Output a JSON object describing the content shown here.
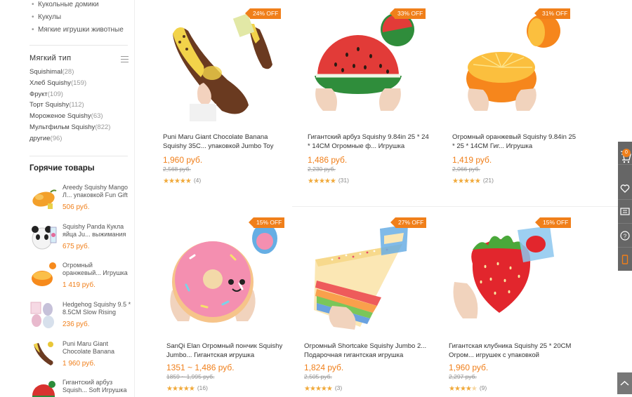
{
  "categories": [
    "Кукольные домики",
    "Кукулы",
    "Мягкие игрушки животные"
  ],
  "soft_type": {
    "title": "Мягкий тип",
    "items": [
      {
        "label": "Squishimal",
        "count": "(28)"
      },
      {
        "label": "Хлеб Squishy",
        "count": "(159)"
      },
      {
        "label": "Фрукт",
        "count": "(109)"
      },
      {
        "label": "Торт Squishy",
        "count": "(112)"
      },
      {
        "label": "Мороженое Squishy",
        "count": "(63)"
      },
      {
        "label": "Мультфильм Squishy",
        "count": "(822)"
      },
      {
        "label": "другие",
        "count": "(96)"
      }
    ]
  },
  "hot": {
    "title": "Горячие товары",
    "items": [
      {
        "name": "Areedy Squishy Mango Л... упаковкой Fun Gift",
        "price": "506 руб."
      },
      {
        "name": "Squishy Panda Кукла яйца Ju... выжимания",
        "price": "675 руб."
      },
      {
        "name": "Огромный оранжевый... Игрушка",
        "price": "1 419 руб."
      },
      {
        "name": "Hedgehog Squishy 9.5 * 8.5CM Slow Rising",
        "price": "236 руб."
      },
      {
        "name": "Puni Maru Giant Chocolate Banana",
        "price": "1 960 руб."
      },
      {
        "name": "Гигантский арбуз Squish... Soft Игрушка",
        "price": ""
      }
    ]
  },
  "products": [
    {
      "badge": "24% OFF",
      "title": "Puni Maru Giant Chocolate Banana Squishy 35C... упаковкой Jumbo Toy",
      "price": "1,960 руб.",
      "old": "2,568 руб.",
      "reviews": "(4)",
      "rating": 5
    },
    {
      "badge": "33% OFF",
      "title": "Гигантский арбуз Squishy 9.84in 25 * 24 * 14CM Огромные ф... Игрушка",
      "price": "1,486 руб.",
      "old": "2,230 руб.",
      "reviews": "(31)",
      "rating": 5
    },
    {
      "badge": "31% OFF",
      "title": "Огромный оранжевый Squishy 9.84in 25 * 25 * 14CM Гиг... Игрушка",
      "price": "1,419 руб.",
      "old": "2,066 руб.",
      "reviews": "(21)",
      "rating": 5
    },
    {
      "badge": "15% OFF",
      "title": "SanQi Elan Огромный пончик Squishy Jumbo... Гигантская игрушка",
      "price": "1351 ~ 1,486 руб.",
      "old": "1859 ~ 1,995 руб.",
      "reviews": "(16)",
      "rating": 5
    },
    {
      "badge": "27% OFF",
      "title": "Огромный Shortcake Squishy Jumbo 2... Подарочная гигантская игрушка",
      "price": "1,824 руб.",
      "old": "2,505 руб.",
      "reviews": "(3)",
      "rating": 5
    },
    {
      "badge": "15% OFF",
      "title": "Гигантская клубника Squishy 25 * 20CM Огром... игрушек с упаковкой",
      "price": "1,960 руб.",
      "old": "2,297 руб.",
      "reviews": "(9)",
      "rating": 4.5
    }
  ],
  "rail": {
    "cart_count": "0"
  },
  "colors": {
    "accent": "#f07f1a",
    "star": "#f0a93a",
    "rail": "#666666"
  }
}
